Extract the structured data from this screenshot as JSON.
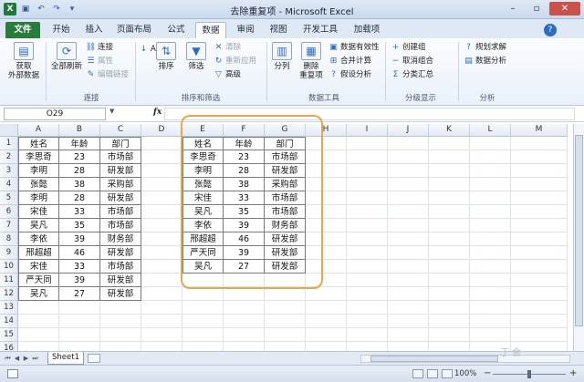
{
  "window": {
    "title": "去除重复项 - Microsoft Excel",
    "app_icon": "X",
    "minimize": "–",
    "maximize": "▫",
    "close": "✕"
  },
  "qat": [
    "save-icon",
    "undo-icon",
    "redo-icon",
    "customize-icon"
  ],
  "tabs": [
    "文件",
    "开始",
    "插入",
    "页面布局",
    "公式",
    "数据",
    "审阅",
    "视图",
    "开发工具",
    "加载项"
  ],
  "active_tab": "数据",
  "ribbon": {
    "get_external": "获取\n外部数据",
    "refresh_all": "全部刷新",
    "connections": "连接",
    "properties": "属性",
    "edit_links": "编辑链接",
    "group_connections": "连接",
    "sort_az": "A↓Z",
    "sort": "排序",
    "filter": "筛选",
    "clear": "清除",
    "reapply": "重新应用",
    "advanced": "高级",
    "group_sort": "排序和筛选",
    "text_to_columns": "分列",
    "remove_duplicates": "删除\n重复项",
    "data_validation": "数据有效性",
    "consolidate": "合并计算",
    "what_if": "假设分析",
    "group_tools": "数据工具",
    "group": "创建组",
    "ungroup": "取消组合",
    "subtotal": "分类汇总",
    "group_outline": "分级显示",
    "solver": "规划求解",
    "data_analysis": "数据分析",
    "group_analysis": "分析"
  },
  "formula_bar": {
    "name_box": "O29",
    "fx": "fx",
    "formula": ""
  },
  "columns": [
    "A",
    "B",
    "C",
    "D",
    "E",
    "F",
    "G",
    "H",
    "I",
    "J",
    "K",
    "L",
    "M"
  ],
  "rows": [
    "1",
    "2",
    "3",
    "4",
    "5",
    "6",
    "7",
    "8",
    "9",
    "10",
    "11",
    "12",
    "13",
    "14",
    "15",
    "16",
    "17"
  ],
  "table_left": {
    "headers": [
      "姓名",
      "年龄",
      "部门"
    ],
    "rows": [
      [
        "李思奇",
        "23",
        "市场部"
      ],
      [
        "李明",
        "28",
        "研发部"
      ],
      [
        "张懿",
        "38",
        "采购部"
      ],
      [
        "李明",
        "28",
        "研发部"
      ],
      [
        "宋佳",
        "33",
        "市场部"
      ],
      [
        "吴凡",
        "35",
        "市场部"
      ],
      [
        "李依",
        "39",
        "财务部"
      ],
      [
        "邢超超",
        "46",
        "研发部"
      ],
      [
        "宋佳",
        "33",
        "市场部"
      ],
      [
        "严天同",
        "39",
        "研发部"
      ],
      [
        "吴凡",
        "27",
        "研发部"
      ]
    ]
  },
  "table_right": {
    "headers": [
      "姓名",
      "年龄",
      "部门"
    ],
    "rows": [
      [
        "李思奇",
        "23",
        "市场部"
      ],
      [
        "李明",
        "28",
        "研发部"
      ],
      [
        "张懿",
        "38",
        "采购部"
      ],
      [
        "宋佳",
        "33",
        "市场部"
      ],
      [
        "吴凡",
        "35",
        "市场部"
      ],
      [
        "李依",
        "39",
        "财务部"
      ],
      [
        "邢超超",
        "46",
        "研发部"
      ],
      [
        "严天同",
        "39",
        "研发部"
      ],
      [
        "吴凡",
        "27",
        "研发部"
      ]
    ]
  },
  "sheet_tabs": [
    "Sheet1"
  ],
  "status": {
    "zoom": "100%",
    "zoom_out": "−",
    "zoom_in": "+"
  },
  "watermark": "丁 会",
  "colors": {
    "file_tab": "#2a7c3d",
    "highlight": "#e6a84a"
  }
}
